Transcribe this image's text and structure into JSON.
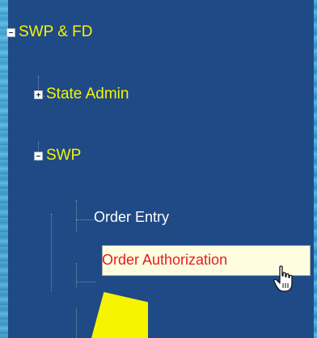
{
  "tree": {
    "root": {
      "label": "SWP & FD",
      "expanded": true
    },
    "state_admin": {
      "label": "State Admin",
      "expanded": false
    },
    "swp": {
      "label": "SWP",
      "expanded": true
    },
    "order_entry": {
      "label": "Order Entry"
    },
    "order_authorization": {
      "label": "Order Authorization",
      "hovered": true
    }
  },
  "colors": {
    "panel_bg": "#1f4a86",
    "folder_text": "#f5f500",
    "item_text": "#ffffff",
    "hover_text": "#e02020",
    "hover_bg": "#fffde0",
    "callout": "#f7f400"
  },
  "icons": [
    "minus-toggle-icon",
    "plus-toggle-icon",
    "hand-pointer-cursor-icon"
  ]
}
